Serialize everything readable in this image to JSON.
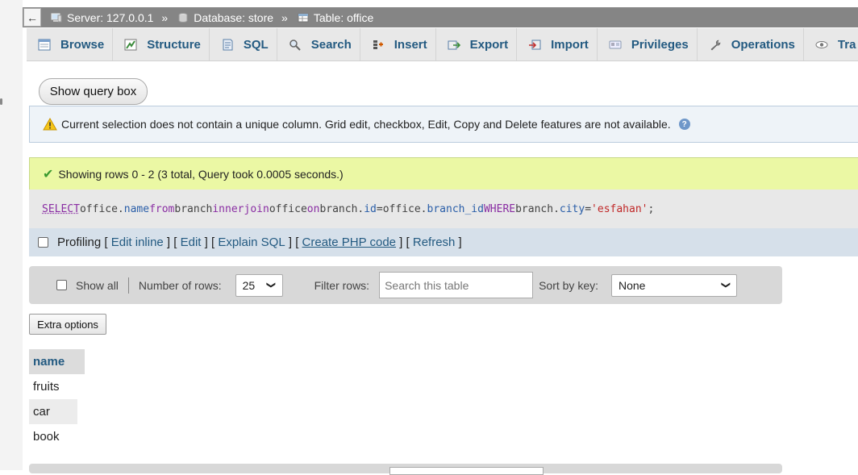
{
  "breadcrumb": {
    "back_label": "←",
    "server": "Server: 127.0.0.1",
    "database": "Database: store",
    "table": "Table: office",
    "separator": "»"
  },
  "tabs": [
    {
      "label": "Browse",
      "icon": "browse-icon"
    },
    {
      "label": "Structure",
      "icon": "structure-icon"
    },
    {
      "label": "SQL",
      "icon": "sql-icon"
    },
    {
      "label": "Search",
      "icon": "search-icon"
    },
    {
      "label": "Insert",
      "icon": "insert-icon"
    },
    {
      "label": "Export",
      "icon": "export-icon"
    },
    {
      "label": "Import",
      "icon": "import-icon"
    },
    {
      "label": "Privileges",
      "icon": "privileges-icon"
    },
    {
      "label": "Operations",
      "icon": "operations-icon"
    },
    {
      "label": "Tra",
      "icon": "tracking-icon"
    }
  ],
  "query_box_button": "Show query box",
  "notice": {
    "text": "Current selection does not contain a unique column. Grid edit, checkbox, Edit, Copy and Delete features are not available.",
    "help": "?"
  },
  "success": {
    "text": "Showing rows 0 - 2 (3 total, Query took 0.0005 seconds.)"
  },
  "sql": {
    "select": "SELECT",
    "t1": "office.",
    "c1": "name",
    "from": "from",
    "t2": "branch",
    "inner": "inner",
    "join": "join",
    "t3": "office",
    "on": "on",
    "t4": "branch.",
    "c2": "id",
    "eq1": "=",
    "t5": "office.",
    "c3": "branch_id",
    "where": "WHERE",
    "t6": "branch.",
    "c4": "city",
    "eq2": "=",
    "val": "'esfahan'",
    "end": ";"
  },
  "profiling": {
    "label": "Profiling",
    "links": [
      "Edit inline",
      "Edit",
      "Explain SQL",
      "Create PHP code",
      "Refresh"
    ]
  },
  "nav": {
    "show_all": "Show all",
    "number_of_rows_label": "Number of rows:",
    "number_of_rows_value": "25",
    "filter_label": "Filter rows:",
    "filter_placeholder": "Search this table",
    "sort_label": "Sort by key:",
    "sort_value": "None"
  },
  "extra_options": "Extra options",
  "results": {
    "column": "name",
    "rows": [
      "fruits",
      "car",
      "book"
    ]
  },
  "colors": {
    "link": "#235a81",
    "success_bg": "#ebf8a4",
    "notice_bg": "#eef3f8",
    "topbar": "#858585"
  }
}
